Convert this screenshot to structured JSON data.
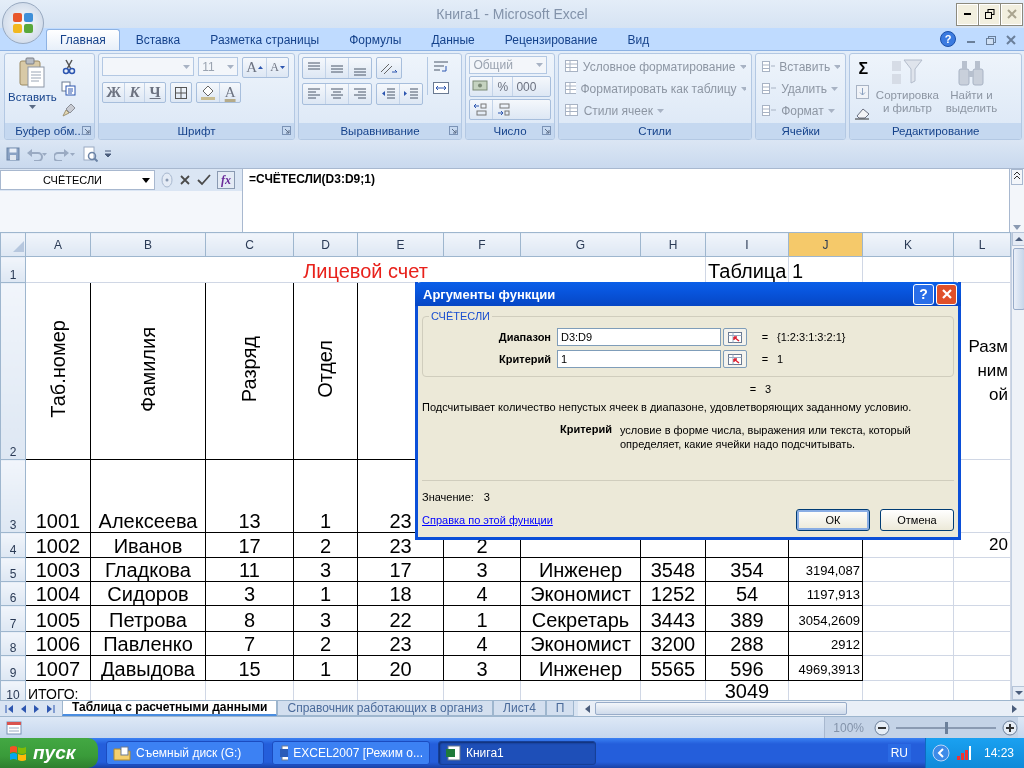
{
  "window": {
    "title": "Книга1 - Microsoft Excel"
  },
  "ribbon_tabs": [
    {
      "label": "Главная",
      "selected": true
    },
    {
      "label": "Вставка",
      "selected": false
    },
    {
      "label": "Разметка страницы",
      "selected": false
    },
    {
      "label": "Формулы",
      "selected": false
    },
    {
      "label": "Данные",
      "selected": false
    },
    {
      "label": "Рецензирование",
      "selected": false
    },
    {
      "label": "Вид",
      "selected": false
    }
  ],
  "help_button": "?",
  "ribbon": {
    "clipboard": {
      "label": "Буфер обм...",
      "paste": "Вставить"
    },
    "font": {
      "label": "Шрифт",
      "size": "11",
      "grow": "A",
      "shrink": "A",
      "bold": "Ж",
      "italic": "К",
      "underline": "Ч",
      "font_color": "A"
    },
    "alignment": {
      "label": "Выравнивание"
    },
    "number": {
      "label": "Число",
      "format": "Общий",
      "percent": "%",
      "thousands": "000"
    },
    "styles": {
      "label": "Стили",
      "items": [
        {
          "label": "Условное форматирование",
          "disabled": true
        },
        {
          "label": "Форматировать как таблицу",
          "disabled": true
        },
        {
          "label": "Стили ячеек",
          "disabled": true
        }
      ]
    },
    "cells": {
      "label": "Ячейки",
      "items": [
        {
          "label": "Вставить",
          "disabled": true
        },
        {
          "label": "Удалить",
          "disabled": true
        },
        {
          "label": "Формат",
          "disabled": true
        }
      ]
    },
    "editing": {
      "label": "Редактирование",
      "autosum": "Σ",
      "tools": [
        {
          "label": "Сортировка и фильтр",
          "disabled": true
        },
        {
          "label": "Найти и выделить",
          "disabled": true
        }
      ]
    }
  },
  "formula_bar": {
    "name_box": "СЧЁТЕСЛИ",
    "fx": "fx",
    "formula": "=СЧЁТЕСЛИ(D3:D9;1)"
  },
  "sheet": {
    "columns": [
      {
        "label": "A",
        "selected": false
      },
      {
        "label": "B",
        "selected": false
      },
      {
        "label": "C",
        "selected": false
      },
      {
        "label": "D",
        "selected": false
      },
      {
        "label": "E",
        "selected": false
      },
      {
        "label": "F",
        "selected": false
      },
      {
        "label": "G",
        "selected": false
      },
      {
        "label": "H",
        "selected": false
      },
      {
        "label": "I",
        "selected": false
      },
      {
        "label": "J",
        "selected": true
      },
      {
        "label": "K",
        "selected": false
      },
      {
        "label": "L",
        "selected": false
      }
    ],
    "rows": [
      {
        "label": "1",
        "kind": "title",
        "title": "Лицевой счет",
        "caption": "Таблица 1"
      },
      {
        "label": "2",
        "kind": "header",
        "cells": [
          "Таб.номер",
          "Фамилия",
          "Разряд",
          "Отдел",
          null,
          null,
          null,
          null,
          null,
          null,
          null,
          "Разм\nним\nой"
        ]
      },
      {
        "label": "3",
        "kind": "data",
        "cells": [
          "1001",
          "Алексеева",
          "13",
          "1",
          "23",
          null,
          null,
          null,
          null,
          null,
          null,
          null
        ]
      },
      {
        "label": "4",
        "kind": "data",
        "cells": [
          "1002",
          "Иванов",
          "17",
          "2",
          "23",
          "2",
          null,
          null,
          null,
          null,
          null,
          "20"
        ]
      },
      {
        "label": "5",
        "kind": "data",
        "cells": [
          "1003",
          "Гладкова",
          "11",
          "3",
          "17",
          "3",
          "Инженер",
          "3548",
          "354",
          "3194,087",
          null,
          null
        ]
      },
      {
        "label": "6",
        "kind": "data",
        "cells": [
          "1004",
          "Сидоров",
          "3",
          "1",
          "18",
          "4",
          "Экономист",
          "1252",
          "54",
          "1197,913",
          null,
          null
        ]
      },
      {
        "label": "7",
        "kind": "data",
        "cells": [
          "1005",
          "Петрова",
          "8",
          "3",
          "22",
          "1",
          "Секретарь",
          "3443",
          "389",
          "3054,2609",
          null,
          null
        ]
      },
      {
        "label": "8",
        "kind": "data",
        "cells": [
          "1006",
          "Павленко",
          "7",
          "2",
          "23",
          "4",
          "Экономист",
          "3200",
          "288",
          "2912",
          null,
          null
        ]
      },
      {
        "label": "9",
        "kind": "data",
        "cells": [
          "1007",
          "Давыдова",
          "15",
          "1",
          "20",
          "3",
          "Инженер",
          "5565",
          "596",
          "4969,3913",
          null,
          null
        ]
      },
      {
        "label": "10",
        "kind": "total",
        "cells": [
          "ИТОГО:",
          null,
          null,
          null,
          null,
          null,
          null,
          null,
          "3049",
          null,
          null,
          null
        ]
      }
    ]
  },
  "dialog": {
    "title": "Аргументы функции",
    "help": "?",
    "function": "СЧЁТЕСЛИ",
    "args": [
      {
        "label": "Диапазон",
        "value": "D3:D9",
        "eq": "=",
        "result": "{1:2:3:1:3:2:1}"
      },
      {
        "label": "Критерий",
        "value": "1",
        "eq": "=",
        "result": "1"
      }
    ],
    "total_eq": "=",
    "total": "3",
    "description": "Подсчитывает количество непустых ячеек в диапазоне, удовлетворяющих заданному условию.",
    "arg_help_label": "Критерий",
    "arg_help": "условие в форме числа, выражения или текста, который определяет, какие ячейки надо подсчитывать.",
    "value_label": "Значение:",
    "value": "3",
    "link": "Справка по этой функции",
    "buttons": [
      {
        "label": "ОК",
        "default": true
      },
      {
        "label": "Отмена",
        "default": false
      }
    ]
  },
  "sheet_tabs": [
    {
      "label": "Таблица с расчетными данными",
      "selected": true
    },
    {
      "label": "Справочник работающих в организ",
      "selected": false
    },
    {
      "label": "Лист4",
      "selected": false
    },
    {
      "label": "П",
      "selected": false
    }
  ],
  "status_bar": {
    "zoom": "100%",
    "zoom_slider": {
      "level": 0.5
    }
  },
  "taskbar": {
    "start": "пуск",
    "items": [
      {
        "label": "Съемный диск (G:)",
        "selected": false,
        "kind": "folder"
      },
      {
        "label": "EXCEL2007 [Режим о...",
        "selected": false,
        "kind": "word"
      },
      {
        "label": "Книга1",
        "selected": true,
        "kind": "excel"
      }
    ],
    "language": "RU",
    "clock": "14:23"
  }
}
